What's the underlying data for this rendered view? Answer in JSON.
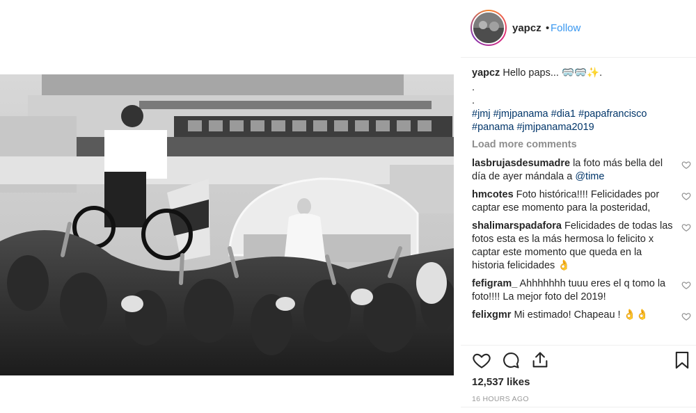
{
  "post": {
    "username": "yapcz",
    "dot": "•",
    "follow_label": "Follow",
    "caption": {
      "user": "yapcz",
      "text": "Hello paps...",
      "emoji": "🥽🥽✨.",
      "dot1": ".",
      "dot2": ".",
      "hashtags_line1": "#jmj #jmjpanama #dia1 #papafrancisco",
      "hashtags_line2": "#panama #jmjpanama2019"
    },
    "load_more": "Load more comments",
    "comments": [
      {
        "user": "lasbrujasdesumadre",
        "text": "la foto más bella del día de ayer mándala a",
        "mention": "@time"
      },
      {
        "user": "hmcotes",
        "text": "Foto histórica!!!! Felicidades por captar ese momento para la posteridad,"
      },
      {
        "user": "shalimarspadafora",
        "text": "Felicidades de todas las fotos esta es la más hermosa lo felicito x captar este momento que queda en la historia felicidades 👌"
      },
      {
        "user": "fefigram_",
        "text": "Ahhhhhhh tuuu eres el q tomo la foto!!!! La mejor foto del 2019!"
      },
      {
        "user": "felixgmr",
        "text": "Mi estimado! Chapeau ! 👌👌"
      }
    ],
    "likes": "12,537 likes",
    "time_ago": "16 HOURS AGO"
  }
}
